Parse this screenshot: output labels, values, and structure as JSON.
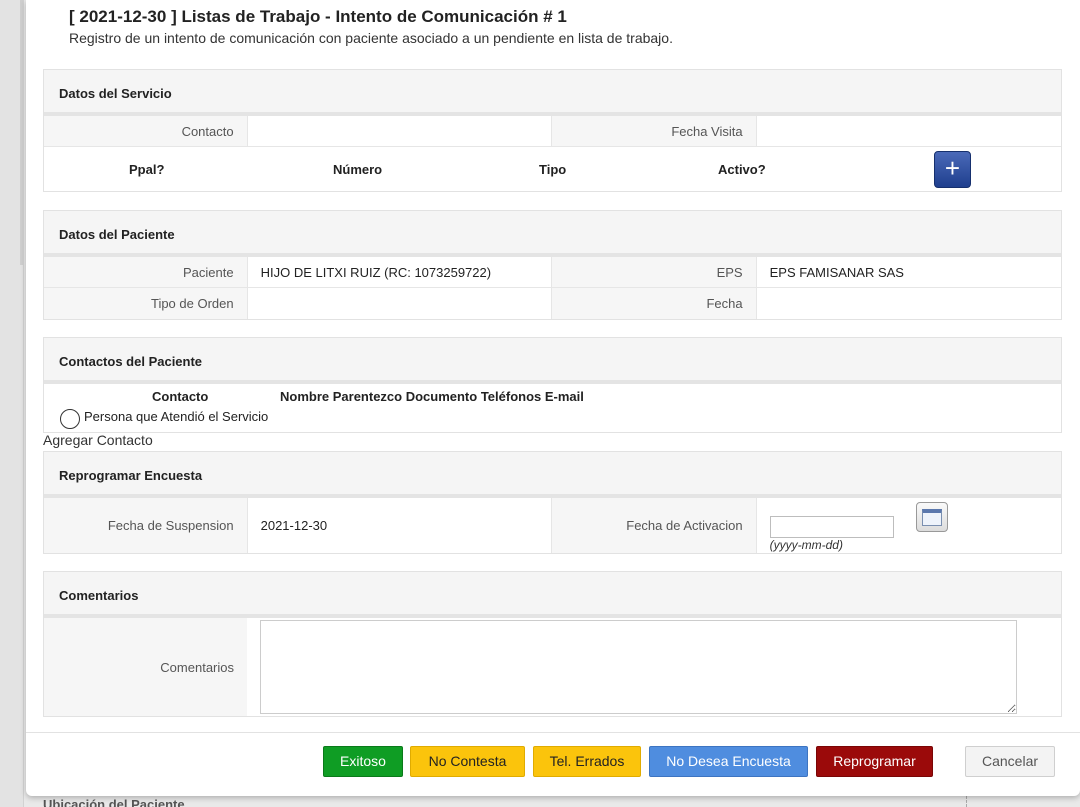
{
  "dialog": {
    "title": "[ 2021-12-30 ] Listas de Trabajo - Intento de Comunicación # 1",
    "subtitle": "Registro de un intento de comunicación con paciente asociado a un pendiente en lista de trabajo."
  },
  "servicio": {
    "heading": "Datos del Servicio",
    "contacto_label": "Contacto",
    "contacto_value": "",
    "fecha_visita_label": "Fecha Visita",
    "fecha_visita_value": "",
    "phone_columns": [
      "Ppal?",
      "Número",
      "Tipo",
      "Activo?"
    ],
    "add_phone_symbol": "+"
  },
  "paciente": {
    "heading": "Datos del Paciente",
    "paciente_label": "Paciente",
    "paciente_value": "HIJO DE LITXI RUIZ (RC: 1073259722)",
    "eps_label": "EPS",
    "eps_value": "EPS FAMISANAR SAS",
    "tipo_orden_label": "Tipo de Orden",
    "tipo_orden_value": "",
    "fecha_label": "Fecha",
    "fecha_value": ""
  },
  "contactos": {
    "heading": "Contactos del Paciente",
    "contacto_col": "Contacto",
    "columns_text": "Nombre Parentezco Documento Teléfonos E-mail",
    "radio_label": "Persona que Atendió el Servicio",
    "add_contact": "Agregar Contacto"
  },
  "reprogramar": {
    "heading": "Reprogramar Encuesta",
    "suspension_label": "Fecha de Suspension",
    "suspension_value": "2021-12-30",
    "activacion_label": "Fecha de Activacion",
    "activacion_value": "",
    "date_hint": "(yyyy-mm-dd)"
  },
  "comentarios": {
    "heading": "Comentarios",
    "label": "Comentarios",
    "value": ""
  },
  "buttons": {
    "exitoso": "Exitoso",
    "no_contesta": "No Contesta",
    "tel_errados": "Tel. Errados",
    "no_desea": "No Desea Encuesta",
    "reprogramar": "Reprogramar",
    "cancelar": "Cancelar"
  },
  "background": {
    "section_text": "Ubicación del Paciente"
  },
  "colors": {
    "exitoso": "#0f9d24",
    "warning": "#fbc40c",
    "info": "#4f8ddf",
    "danger": "#9b0a0a",
    "primary_add": "#2a4a9e"
  }
}
